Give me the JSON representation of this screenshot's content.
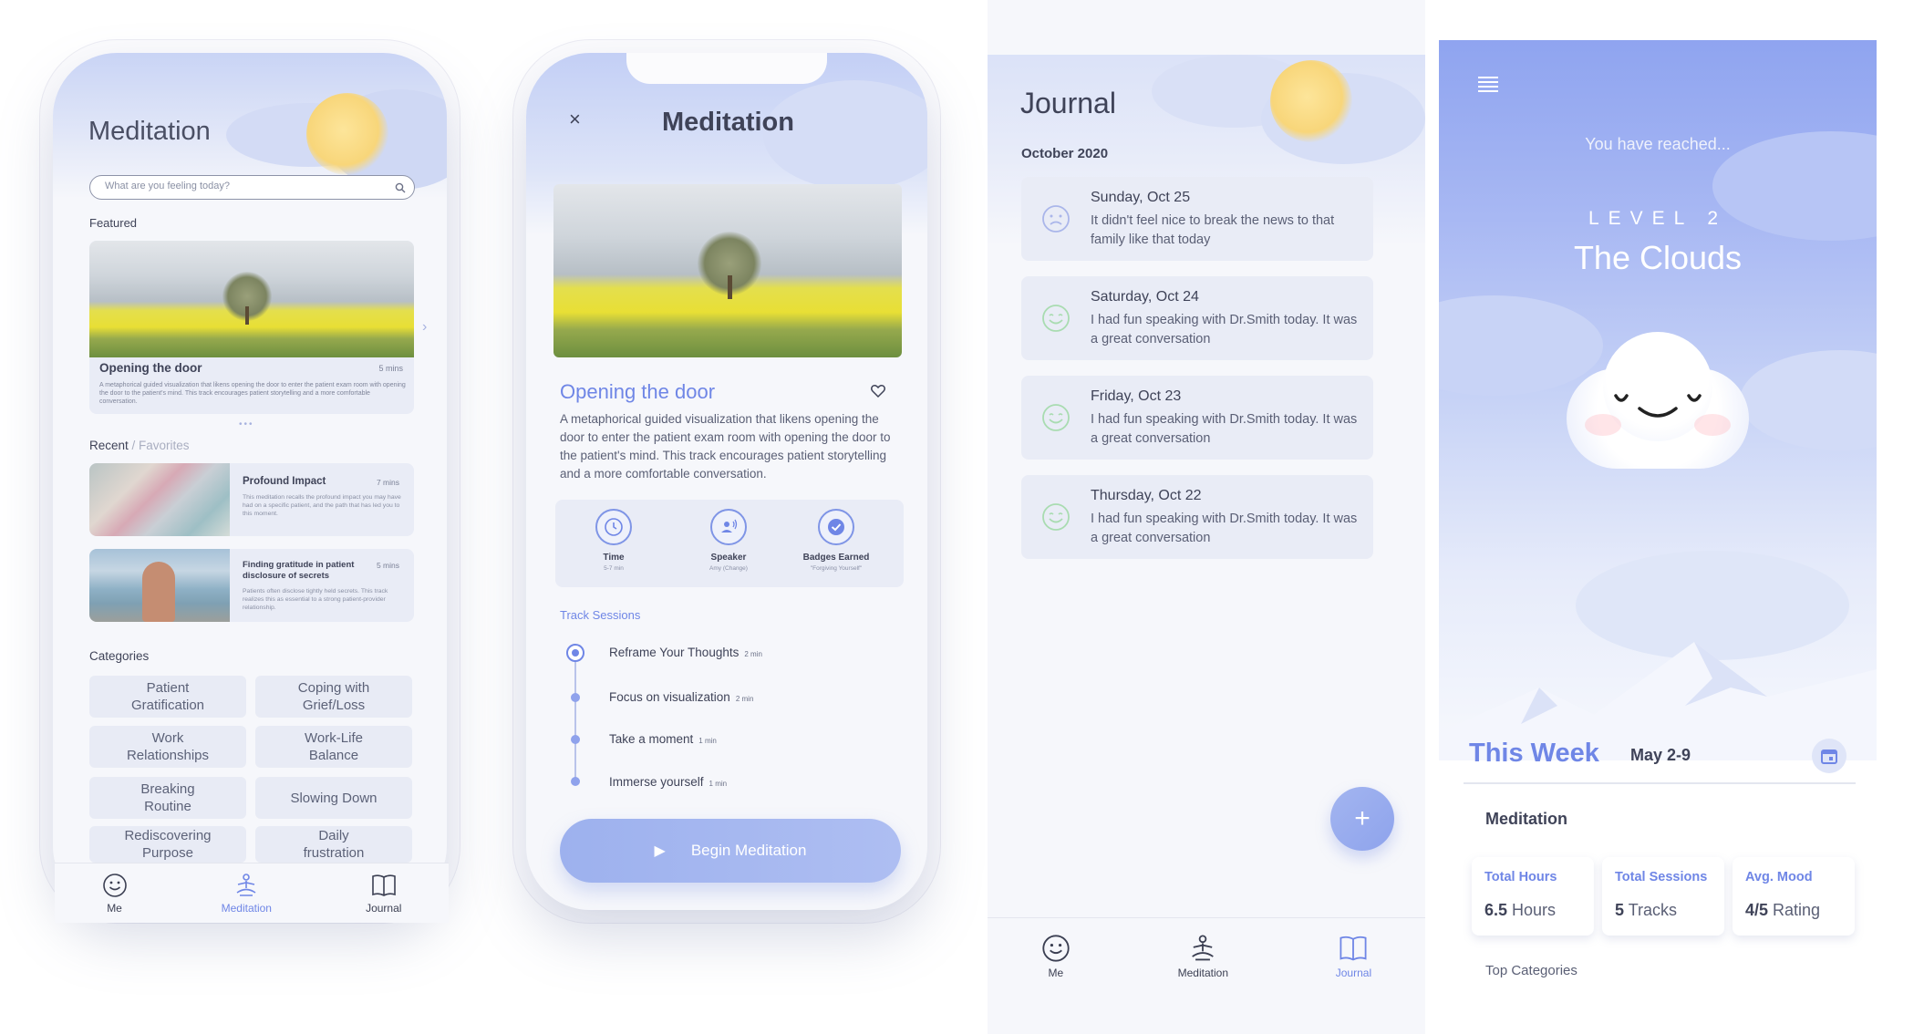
{
  "screen1": {
    "title": "Meditation",
    "search_placeholder": "What are you feeling today?",
    "featured_label": "Featured",
    "featured": {
      "title": "Opening the door",
      "duration": "5 mins",
      "desc": "A metaphorical guided visualization that likens opening the door to enter the patient exam room with opening the door to the patient's mind. This track encourages patient storytelling and a more comfortable conversation."
    },
    "recent_label": "Recent",
    "favorites_label": " / Favorites",
    "recent": [
      {
        "title": "Profound Impact",
        "duration": "7 mins",
        "desc": "This meditation recalls the profound impact you may have had on a specific patient, and the path that has led you to this moment."
      },
      {
        "title": "Finding gratitude in patient disclosure of secrets",
        "duration": "5 mins",
        "desc": "Patients often disclose tightly held secrets. This track realizes this as essential to a strong patient-provider relationship."
      }
    ],
    "categories_label": "Categories",
    "categories": [
      "Patient\nGratification",
      "Coping with\nGrief/Loss",
      "Work\nRelationships",
      "Work-Life\nBalance",
      "Breaking\nRoutine",
      "Slowing Down",
      "Rediscovering\nPurpose",
      "Daily\nfrustration"
    ],
    "nav": [
      "Me",
      "Meditation",
      "Journal"
    ]
  },
  "screen2": {
    "title": "Meditation",
    "track_title": "Opening the door",
    "desc": "A metaphorical guided visualization that likens opening the door to enter the patient exam room with opening the door to the patient's mind. This track encourages patient storytelling and a more comfortable conversation.",
    "features": [
      {
        "label": "Time",
        "sub": "5-7 min"
      },
      {
        "label": "Speaker",
        "sub": "Amy (Change)"
      },
      {
        "label": "Badges Earned",
        "sub": "\"Forgiving Yourself\""
      }
    ],
    "sessions_label": "Track Sessions",
    "sessions": [
      {
        "name": "Reframe Your Thoughts",
        "dur": "2 min"
      },
      {
        "name": "Focus on visualization",
        "dur": "2 min"
      },
      {
        "name": "Take a moment",
        "dur": "1 min"
      },
      {
        "name": "Immerse yourself",
        "dur": "1 min"
      }
    ],
    "begin": "Begin Meditation"
  },
  "screen3": {
    "title": "Journal",
    "month": "October 2020",
    "entries": [
      {
        "date": "Sunday, Oct 25",
        "text": "It didn't feel nice to break the news to that family like that today",
        "mood": "sad"
      },
      {
        "date": "Saturday, Oct 24",
        "text": "I had fun speaking with Dr.Smith today. It was a great conversation",
        "mood": "happy"
      },
      {
        "date": "Friday, Oct 23",
        "text": "I had fun speaking with Dr.Smith today. It was a great conversation",
        "mood": "happy"
      },
      {
        "date": "Thursday, Oct 22",
        "text": "I had fun speaking with Dr.Smith today. It was a great conversation",
        "mood": "happy"
      }
    ],
    "add": "+",
    "nav": [
      "Me",
      "Meditation",
      "Journal"
    ]
  },
  "screen4": {
    "reached": "You have reached...",
    "level": "LEVEL 2",
    "level_name": "The Clouds",
    "week_title": "This Week",
    "week_range": "May 2-9",
    "section": "Meditation",
    "stats": [
      {
        "label": "Total Hours",
        "value": "6.5",
        "unit": " Hours"
      },
      {
        "label": "Total Sessions",
        "value": "5",
        "unit": " Tracks"
      },
      {
        "label": "Avg. Mood",
        "value": "4/5",
        "unit": " Rating"
      }
    ],
    "top_categories": "Top Categories"
  },
  "colors": {
    "accent": "#6f86e6",
    "card": "#e9ecf6",
    "sky_top": "#8fa4f0"
  }
}
